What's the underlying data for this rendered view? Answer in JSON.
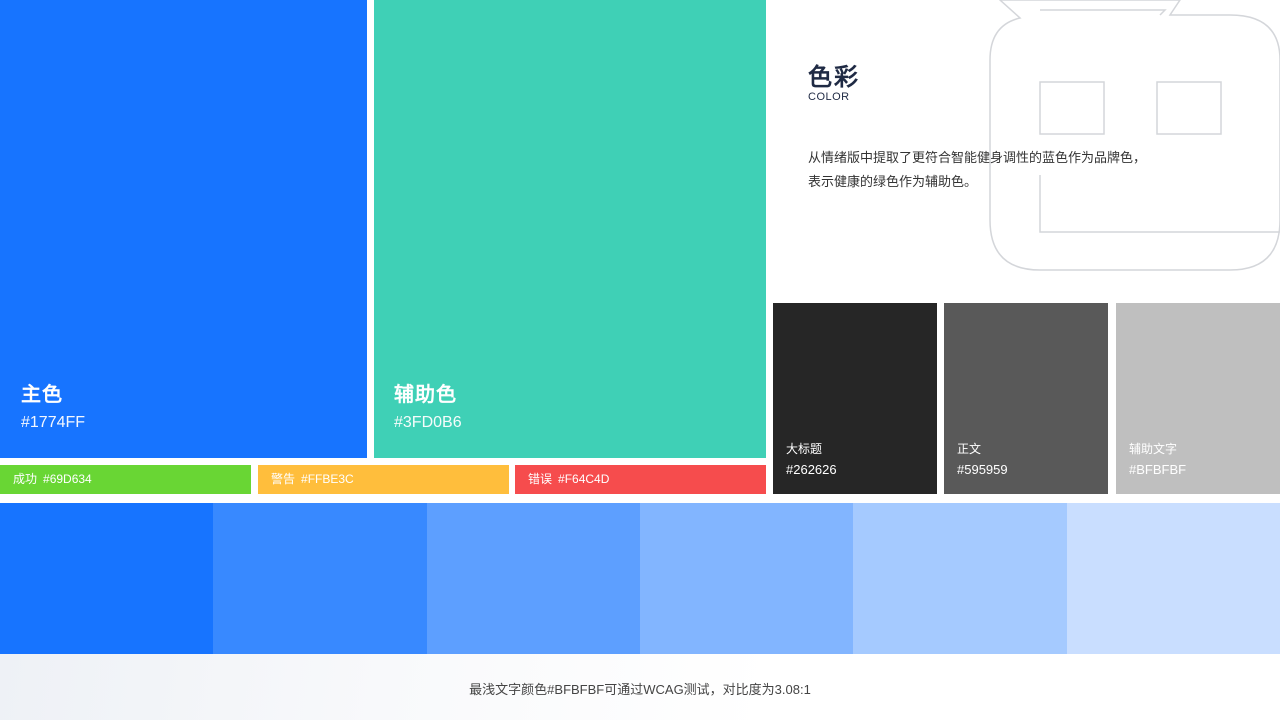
{
  "primary": {
    "title": "主色",
    "code": "#1774FF",
    "color": "#1774FF"
  },
  "secondary": {
    "title": "辅助色",
    "code": "#3FD0B6",
    "color": "#3FD0B6"
  },
  "status": [
    {
      "label": "成功",
      "code": "#69D634",
      "color": "#69D634"
    },
    {
      "label": "警告",
      "code": "#FFBE3C",
      "color": "#FFBE3C"
    },
    {
      "label": "错误",
      "code": "#F64C4D",
      "color": "#F64C4D"
    }
  ],
  "heading": {
    "title": "色彩",
    "subtitle": "COLOR",
    "desc_line1": "从情绪版中提取了更符合智能健身调性的蓝色作为品牌色，",
    "desc_line2": "表示健康的绿色作为辅助色。"
  },
  "text_colors": [
    {
      "label": "大标题",
      "code": "#262626",
      "color": "#262626"
    },
    {
      "label": "正文",
      "code": "#595959",
      "color": "#595959"
    },
    {
      "label": "辅助文字",
      "code": "#BFBFBF",
      "color": "#BFBFBF"
    }
  ],
  "scale": [
    "#1774FF",
    "#3889FF",
    "#5D9FFF",
    "#82B5FF",
    "#A5CAFF",
    "#C9DEFF"
  ],
  "footer": {
    "note": "最浅文字颜色#BFBFBF可通过WCAG测试，对比度为3.08:1"
  }
}
